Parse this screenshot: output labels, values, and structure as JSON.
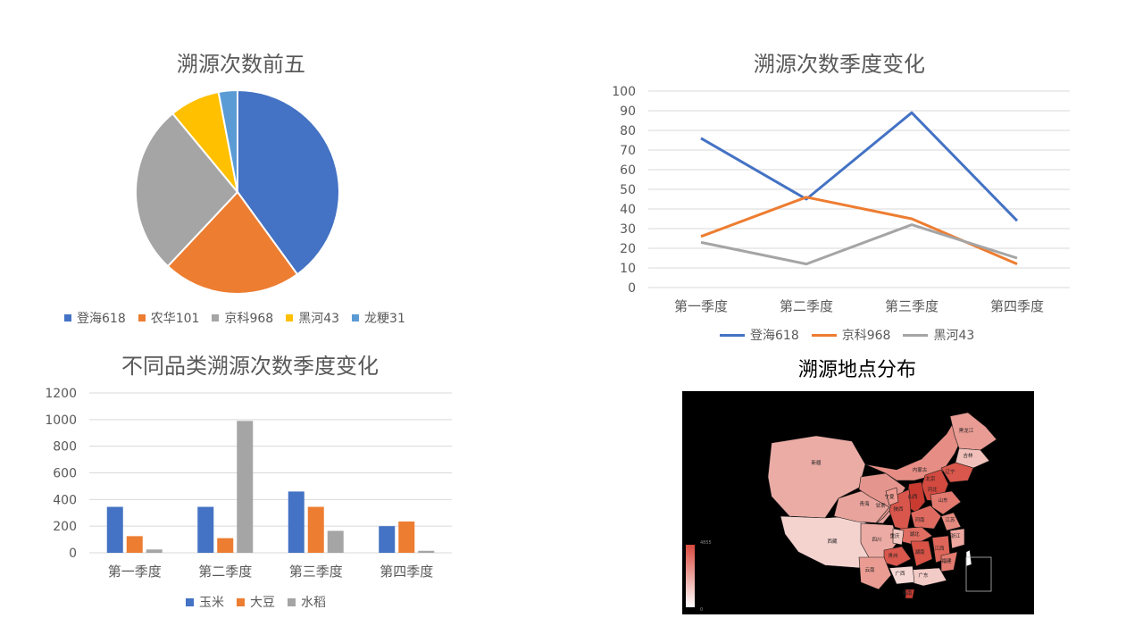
{
  "colors": {
    "blue": "#4472C4",
    "orange": "#ED7D31",
    "gray": "#A5A5A5",
    "yellow": "#FFC000",
    "lightblue": "#5B9BD5"
  },
  "chart_data": [
    {
      "type": "pie",
      "title": "溯源次数前五",
      "categories": [
        "登海618",
        "农华101",
        "京科968",
        "黑河43",
        "龙粳31"
      ],
      "values": [
        40,
        22,
        27,
        8,
        3
      ],
      "colors": [
        "#4472C4",
        "#ED7D31",
        "#A5A5A5",
        "#FFC000",
        "#5B9BD5"
      ],
      "legend": "bottom"
    },
    {
      "type": "line",
      "title": "溯源次数季度变化",
      "categories": [
        "第一季度",
        "第二季度",
        "第三季度",
        "第四季度"
      ],
      "series": [
        {
          "name": "登海618",
          "values": [
            76,
            45,
            89,
            34
          ],
          "color": "#4472C4"
        },
        {
          "name": "京科968",
          "values": [
            26,
            46,
            35,
            12
          ],
          "color": "#ED7D31"
        },
        {
          "name": "黑河43",
          "values": [
            23,
            12,
            32,
            15
          ],
          "color": "#A5A5A5"
        }
      ],
      "ylim": [
        0,
        100
      ],
      "yticks": [
        0,
        10,
        20,
        30,
        40,
        50,
        60,
        70,
        80,
        90,
        100
      ],
      "grid": true,
      "legend": "bottom"
    },
    {
      "type": "bar",
      "title": "不同品类溯源次数季度变化",
      "categories": [
        "第一季度",
        "第二季度",
        "第三季度",
        "第四季度"
      ],
      "series": [
        {
          "name": "玉米",
          "values": [
            345,
            345,
            460,
            200
          ],
          "color": "#4472C4"
        },
        {
          "name": "大豆",
          "values": [
            125,
            110,
            345,
            235
          ],
          "color": "#ED7D31"
        },
        {
          "name": "水稻",
          "values": [
            25,
            990,
            165,
            15
          ],
          "color": "#A5A5A5"
        }
      ],
      "ylim": [
        0,
        1200
      ],
      "yticks": [
        0,
        200,
        400,
        600,
        800,
        1000,
        1200
      ],
      "grid": true,
      "legend": "bottom"
    }
  ],
  "map": {
    "title": "溯源地点分布",
    "scale_max": "4855",
    "scale_min": "0",
    "provinces": [
      "新疆",
      "西藏",
      "青海",
      "甘肃",
      "内蒙古",
      "黑龙江",
      "吉林",
      "辽宁",
      "北京",
      "河北",
      "山西",
      "陕西",
      "宁夏",
      "河南",
      "山东",
      "江苏",
      "湖北",
      "四川",
      "重庆",
      "贵州",
      "云南",
      "湖南",
      "江西",
      "浙江",
      "福建",
      "广东",
      "广西",
      "海南"
    ]
  }
}
